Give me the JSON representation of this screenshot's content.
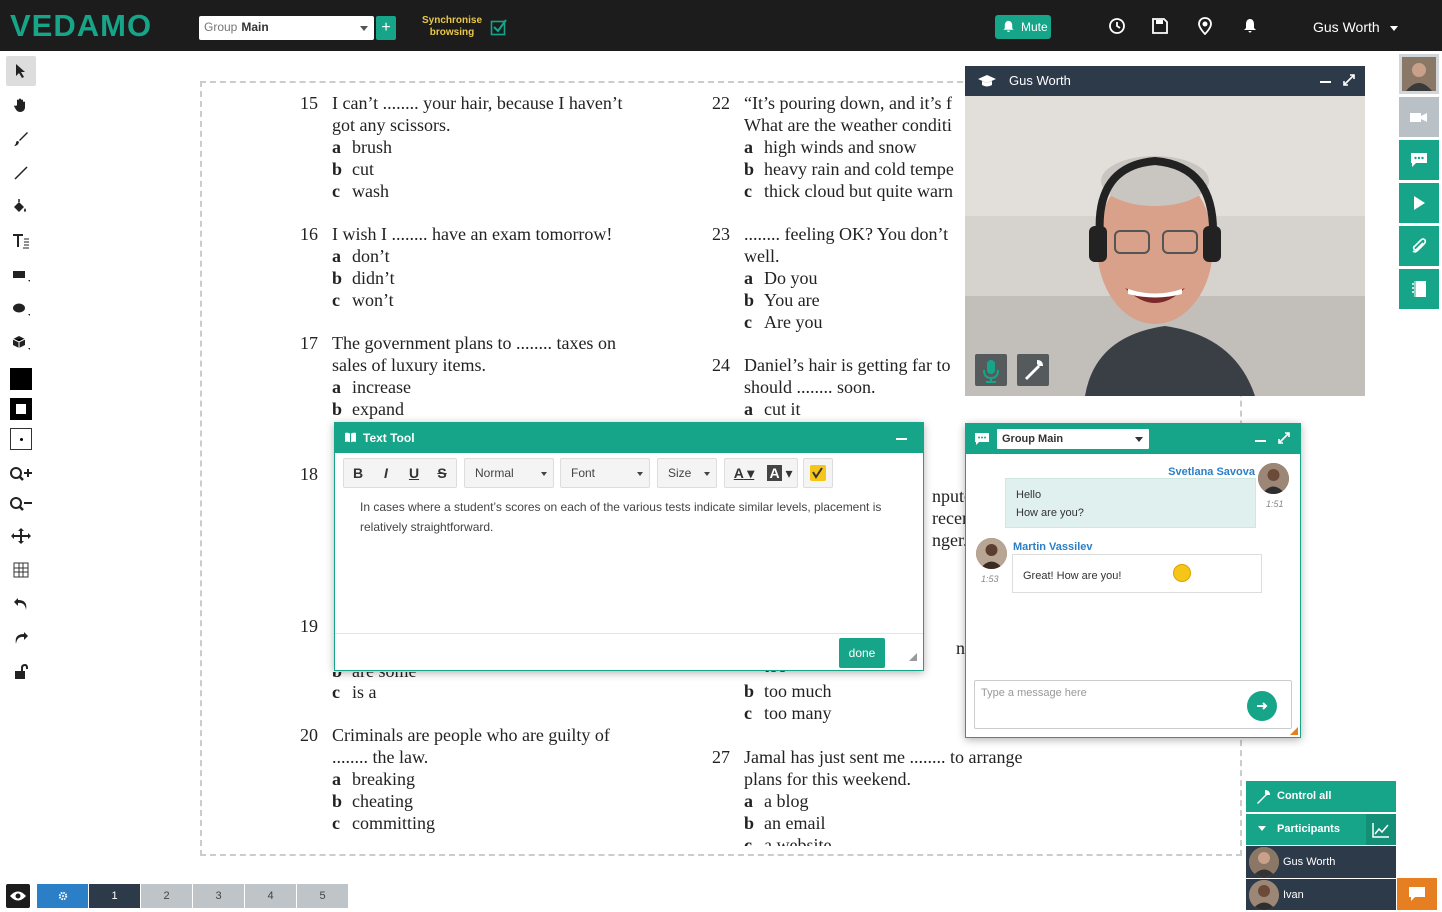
{
  "header": {
    "logo": "VEDAMO",
    "group_prefix": "Group",
    "group_value": "Main",
    "add_symbol": "+",
    "sync_line1": "Synchronise",
    "sync_line2": "browsing",
    "mute_label": "Mute",
    "username": "Gus Worth",
    "accent": "#17a589"
  },
  "toolbar": {
    "icons": [
      "pointer-icon",
      "hand-icon",
      "brush-icon",
      "line-icon",
      "paint-bucket-icon",
      "text-icon",
      "rectangle-icon",
      "ellipse-icon",
      "cube-icon",
      "fill-color-icon",
      "stroke-color-icon",
      "point-size-icon",
      "zoom-in-icon",
      "zoom-out-icon",
      "move-icon",
      "grid-icon",
      "undo-icon",
      "redo-icon",
      "unlock-icon"
    ]
  },
  "document": {
    "left_questions": [
      {
        "num": "15",
        "text": [
          "I can’t  ........ your hair, because I haven’t",
          "got any scissors."
        ],
        "options": [
          [
            "a",
            "brush"
          ],
          [
            "b",
            "cut"
          ],
          [
            "c",
            "wash"
          ]
        ]
      },
      {
        "num": "16",
        "text": [
          "I wish I ........ have an exam tomorrow!"
        ],
        "options": [
          [
            "a",
            "don’t"
          ],
          [
            "b",
            "didn’t"
          ],
          [
            "c",
            "won’t"
          ]
        ]
      },
      {
        "num": "17",
        "text": [
          "The government plans to ........ taxes on",
          "sales of luxury items."
        ],
        "options": [
          [
            "a",
            "increase"
          ],
          [
            "b",
            "expand"
          ]
        ]
      },
      {
        "num": "18"
      },
      {
        "num": "19"
      },
      {
        "num": "20",
        "text": [
          "Criminals are people who are guilty of",
          "........ the law."
        ],
        "options": [
          [
            "a",
            "breaking"
          ],
          [
            "b",
            "cheating"
          ],
          [
            "c",
            "committing"
          ]
        ]
      }
    ],
    "left_partial": {
      "b_fragment": "are some",
      "c_option": [
        "c",
        "is a"
      ]
    },
    "right_questions": [
      {
        "num": "22",
        "text": [
          "“It’s pouring down, and it’s f",
          "What are the weather conditi"
        ],
        "options": [
          [
            "a",
            "high winds and snow"
          ],
          [
            "b",
            "heavy rain and cold tempe"
          ],
          [
            "c",
            "thick cloud but quite warn"
          ]
        ]
      },
      {
        "num": "23",
        "text": [
          "........ feeling OK? You don’t",
          "well."
        ],
        "options": [
          [
            "a",
            "Do you"
          ],
          [
            "b",
            "You are"
          ],
          [
            "c",
            "Are you"
          ]
        ]
      },
      {
        "num": "24",
        "text": [
          "Daniel’s hair is getting far to",
          "should ........ soon."
        ],
        "options": [
          [
            "a",
            "cut it"
          ]
        ]
      },
      {
        "num": "27",
        "text": [
          "Jamal has just sent me ........ to arrange",
          "plans for this weekend."
        ],
        "options": [
          [
            "a",
            "a blog"
          ],
          [
            "b",
            "an email"
          ],
          [
            "c",
            "a website"
          ]
        ]
      }
    ],
    "right_partial": {
      "line1": "nputer",
      "line2": "recen",
      "line3": "nger.",
      "n_fragment": "n",
      "too": "too",
      "b_option": [
        "b",
        "too much"
      ],
      "c_option": [
        "c",
        "too many"
      ]
    }
  },
  "video": {
    "name": "Gus Worth"
  },
  "text_tool": {
    "title": "Text Tool",
    "bold": "B",
    "italic": "I",
    "underline": "U",
    "strike": "S",
    "style": "Normal",
    "font": "Font",
    "size": "Size",
    "font_color_glyph": "A",
    "bg_color_glyph": "A",
    "body": "In cases where a student’s scores on each of the various tests indicate similar levels, placement is relatively straightforward.",
    "done": "done"
  },
  "chat": {
    "group": "Group Main",
    "messages": [
      {
        "name": "Svetlana Savova",
        "lines": [
          "Hello",
          "How are you?"
        ],
        "time": "1:51"
      },
      {
        "name": "Martin Vassilev",
        "lines": [
          "Great! How are you!"
        ],
        "time": "1:53"
      }
    ],
    "placeholder": "Type a message here"
  },
  "participants": {
    "control_label": "Control all participants",
    "list_label": "Participants",
    "people": [
      "Gus Worth",
      "Ivan"
    ]
  },
  "pages": {
    "list": [
      "1",
      "2",
      "3",
      "4",
      "5"
    ],
    "current": "1"
  }
}
